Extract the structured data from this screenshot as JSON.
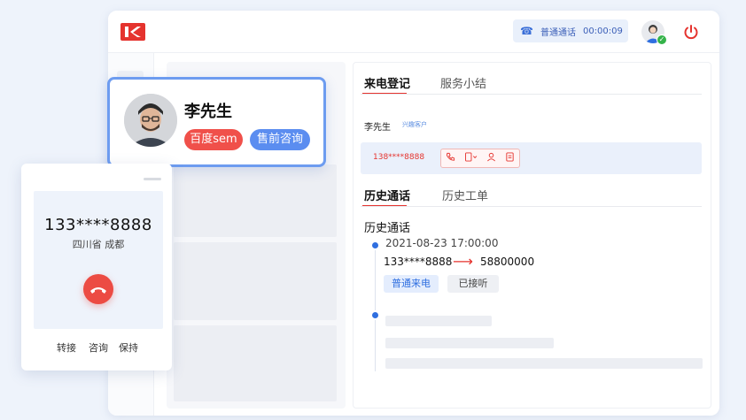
{
  "header": {
    "call_status_label": "普通通话",
    "call_timer": "00:00:09"
  },
  "contact_card": {
    "name": "李先生",
    "badges": [
      "百度sem",
      "售前咨询"
    ]
  },
  "phone_widget": {
    "number": "133****8888",
    "location": "四川省 成都",
    "actions": [
      "转接",
      "咨询",
      "保持"
    ]
  },
  "right_panel": {
    "top_tabs": [
      "来电登记",
      "服务小结"
    ],
    "customer_name": "李先生",
    "customer_tag": "兴趣客户",
    "phone_number": "138****8888",
    "history_tabs": [
      "历史通话",
      "历史工单"
    ],
    "section_title": "历史通话",
    "record": {
      "datetime": "2021-08-23  17:00:00",
      "from": "133****8888",
      "to": "58800000",
      "tags": [
        "普通来电",
        "已接听"
      ]
    }
  },
  "colors": {
    "brand_red": "#e5332e",
    "accent_blue": "#2f6fe0",
    "card_border": "#6d9cf0"
  },
  "icons": [
    "logo-icon",
    "phone-icon",
    "power-icon",
    "call-icon",
    "device-icon",
    "user-icon",
    "note-icon",
    "arrow-right-icon",
    "hangup-icon",
    "online-check-icon"
  ]
}
